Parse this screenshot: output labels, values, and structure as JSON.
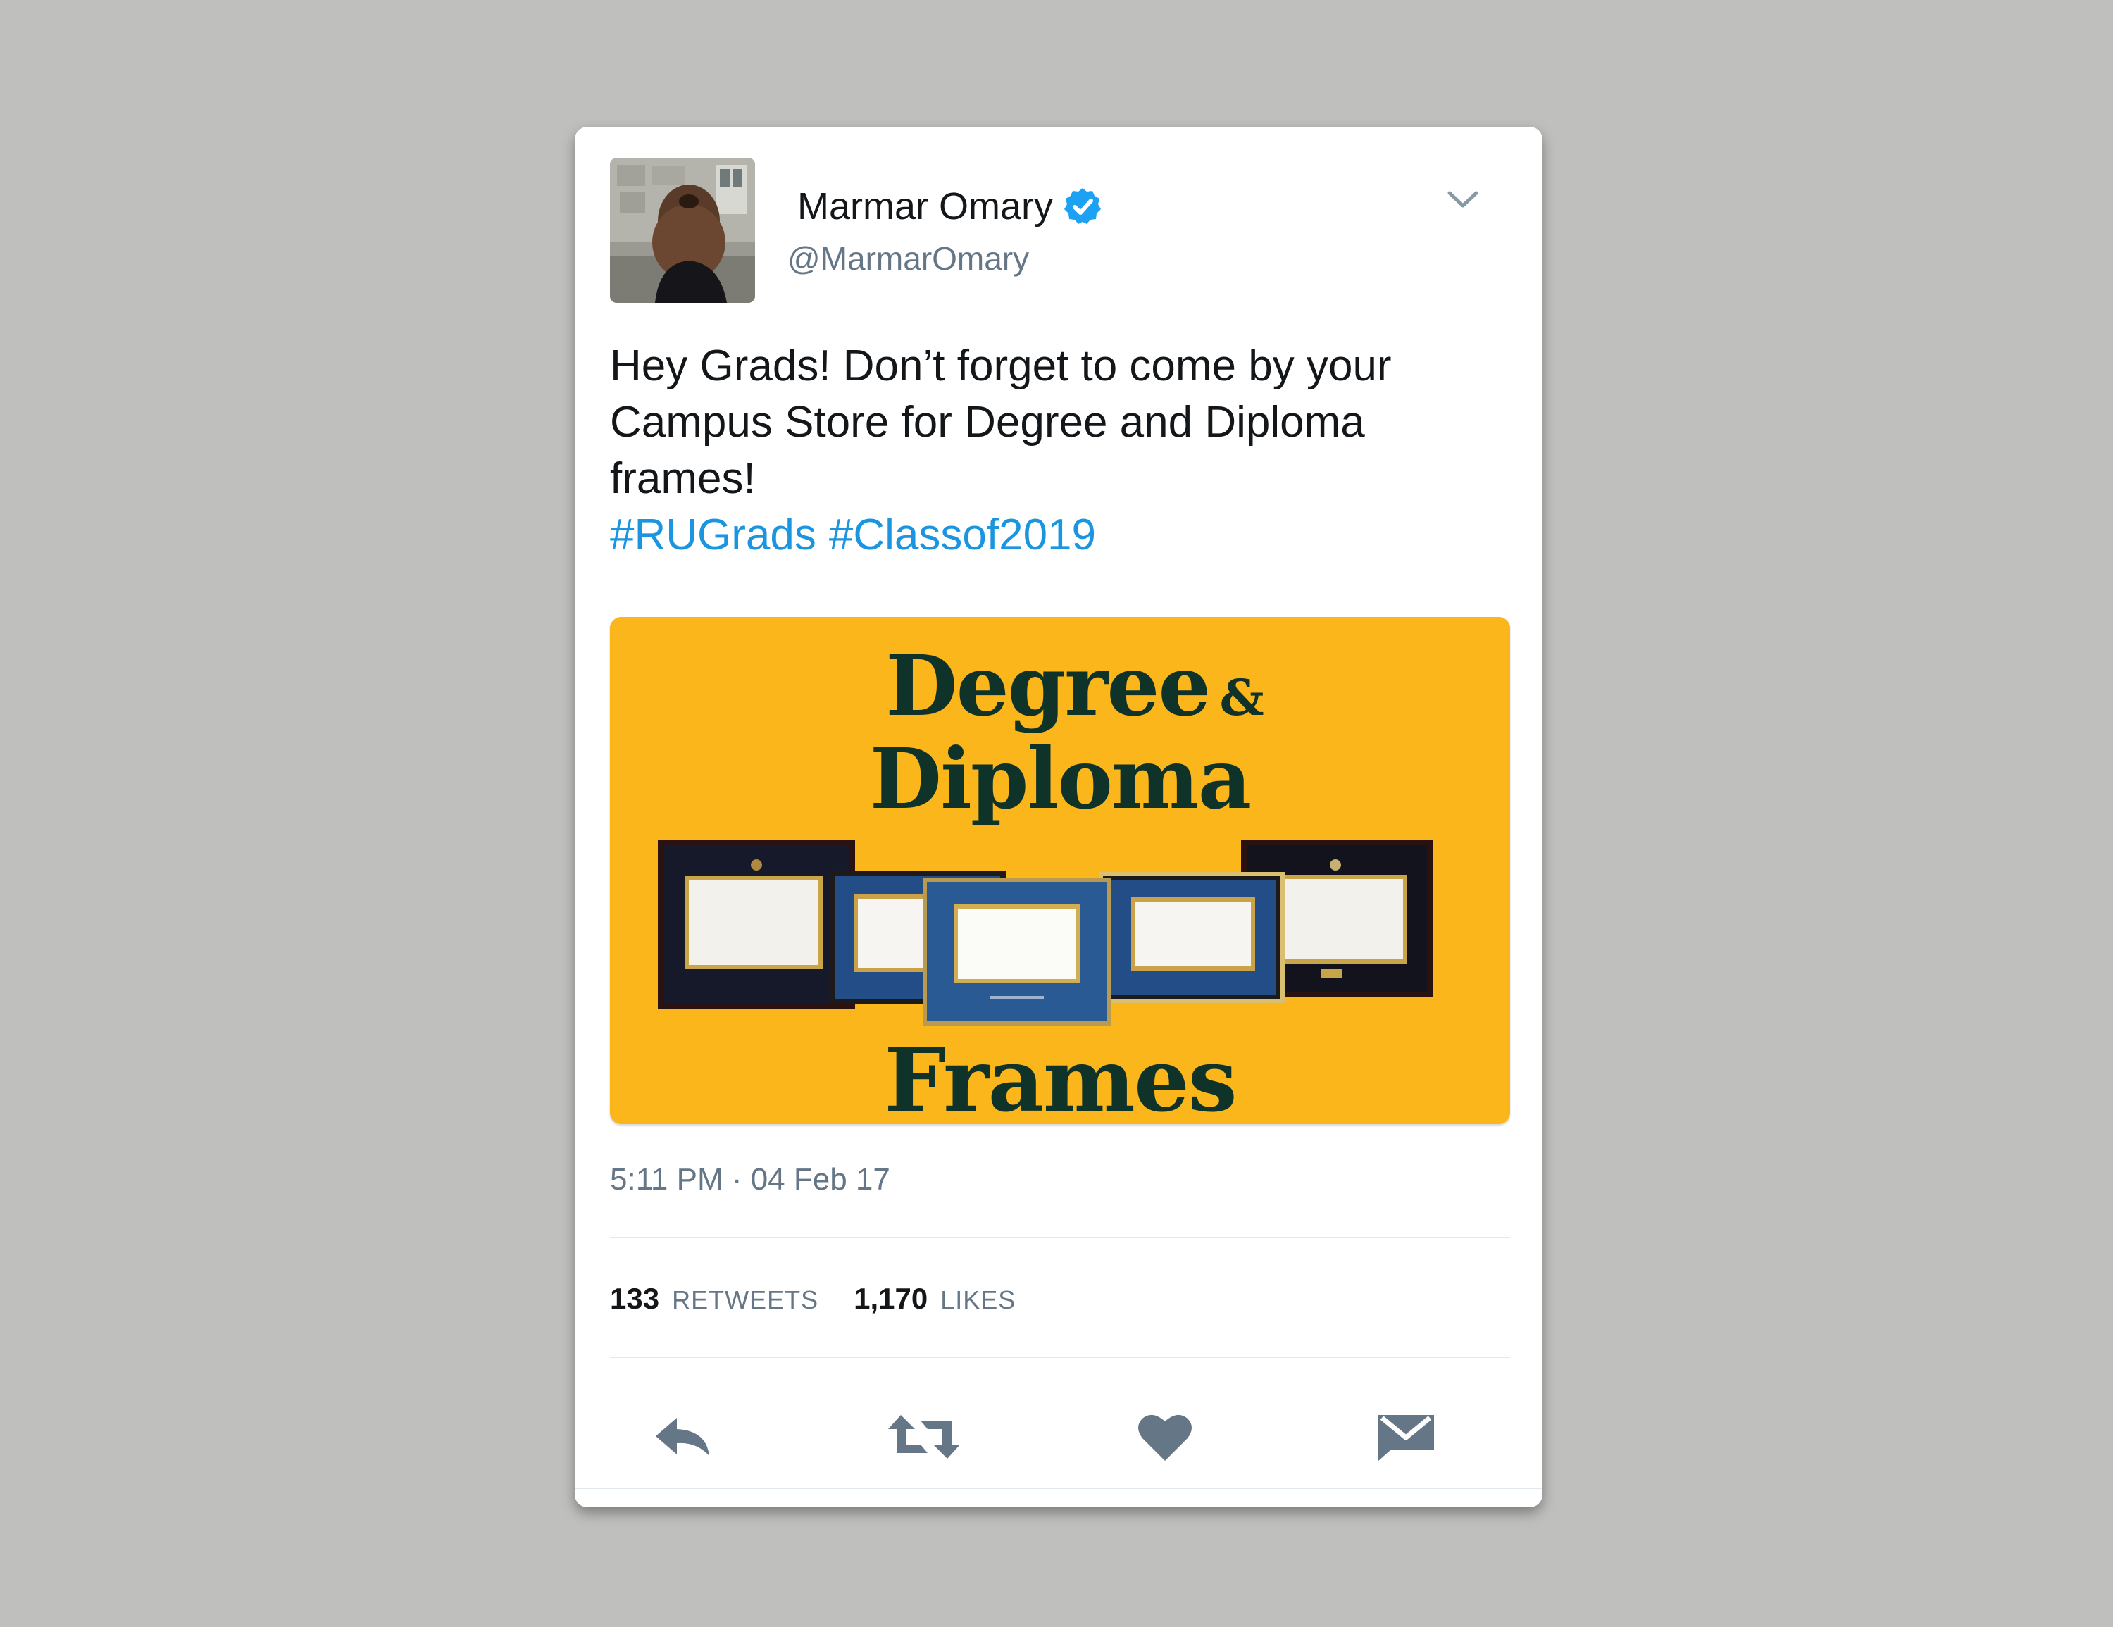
{
  "tweet": {
    "user": {
      "name": "Marmar Omary",
      "handle": "@MarmarOmary",
      "verified": true,
      "avatar_icon": "profile-photo-woman-from-behind"
    },
    "text_lines": [
      "Hey Grads! Don’t forget to come by your",
      "Campus Store for Degree and Diploma",
      "frames!"
    ],
    "hashtags": [
      "#RUGrads",
      "#Classof2019"
    ],
    "media": {
      "title_line1": "Degree",
      "title_amp": "&",
      "title_line2": "Diploma",
      "title_line3": "Frames",
      "background_color": "#fab61a",
      "title_color": "#0f3328"
    },
    "timestamp": "5:11 PM · 04 Feb 17",
    "stats": {
      "retweets_count": "133",
      "retweets_label": "RETWEETS",
      "likes_count": "1,170",
      "likes_label": "LIKES"
    },
    "actions": [
      {
        "name": "reply",
        "icon": "reply-icon"
      },
      {
        "name": "retweet",
        "icon": "retweet-icon"
      },
      {
        "name": "like",
        "icon": "heart-icon"
      },
      {
        "name": "direct-message",
        "icon": "envelope-icon"
      }
    ],
    "colors": {
      "link": "#1b95e0",
      "verified": "#1da1f2",
      "secondary_text": "#657786",
      "icon": "#657786"
    }
  }
}
